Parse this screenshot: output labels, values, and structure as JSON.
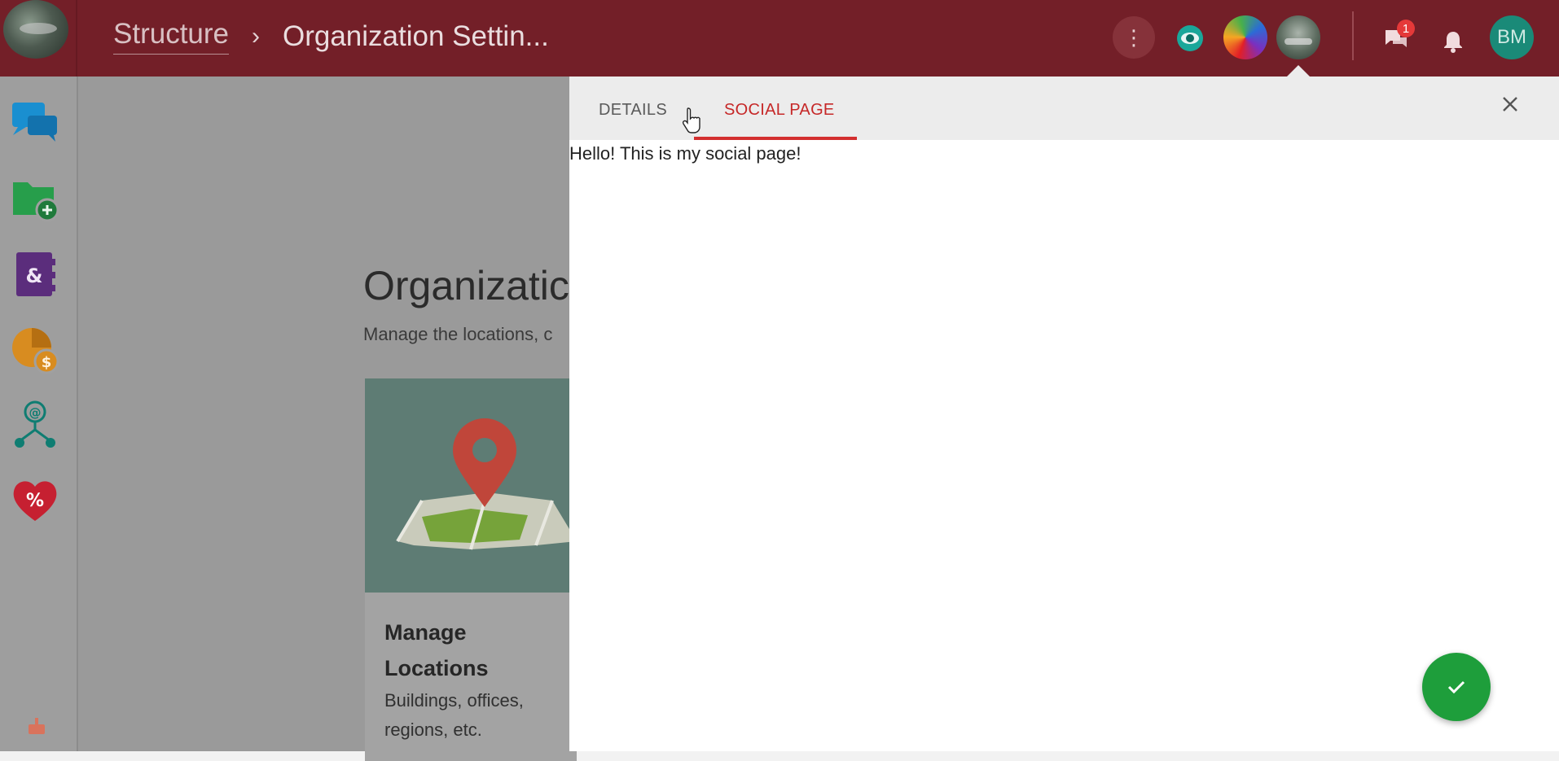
{
  "header": {
    "breadcrumb": {
      "root": "Structure",
      "separator": "›",
      "current": "Organization Settin..."
    },
    "more_icon": "⋮",
    "user_initials": "BM",
    "chat_badge_count": "1",
    "colors": {
      "bar": "#731f28",
      "accent": "#d32f2f"
    }
  },
  "sidebar": {
    "items": [
      {
        "icon": "chat-bubbles-icon"
      },
      {
        "icon": "folder-add-icon"
      },
      {
        "icon": "contacts-book-icon"
      },
      {
        "icon": "finance-pie-icon"
      },
      {
        "icon": "email-network-icon"
      },
      {
        "icon": "heart-percent-icon"
      }
    ],
    "bottom_icon": "cake-icon"
  },
  "background": {
    "page_title": "Organizatic",
    "page_subtitle": "Manage the locations, c",
    "card": {
      "title": "Manage Locations",
      "description": "Buildings, offices, regions, etc."
    }
  },
  "drawer": {
    "tabs": [
      {
        "label": "DETAILS",
        "active": false
      },
      {
        "label": "SOCIAL PAGE",
        "active": true
      }
    ],
    "content_text": "Hello! This is my social page!",
    "fab_color": "#1e9e3b"
  }
}
